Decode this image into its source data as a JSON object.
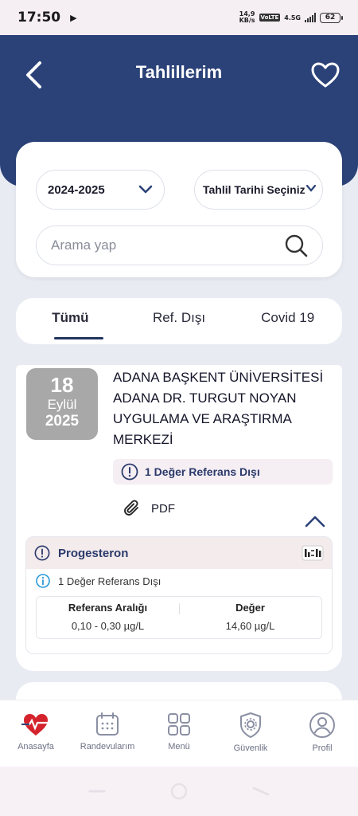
{
  "status_bar": {
    "time": "17:50",
    "speed_top": "14,9",
    "speed_bottom": "KB/s",
    "volte": "VoLTE",
    "network": "4.5G",
    "battery": "62"
  },
  "header": {
    "title": "Tahlillerim"
  },
  "filters": {
    "year_value": "2024-2025",
    "date_placeholder": "Tahlil Tarihi Seçiniz",
    "search_placeholder": "Arama yap"
  },
  "tabs": [
    {
      "label": "Tümü",
      "active": true
    },
    {
      "label": "Ref. Dışı",
      "active": false
    },
    {
      "label": "Covid 19",
      "active": false
    }
  ],
  "result": {
    "day": "18",
    "month": "Eylül",
    "year": "2025",
    "hospital": "ADANA BAŞKENT ÜNİVERSİTESİ ADANA DR. TURGUT NOYAN UYGULAMA VE ARAŞTIRMA MERKEZİ",
    "out_of_ref": "1 Değer Referans Dışı",
    "pdf_label": "PDF",
    "test": {
      "name": "Progesteron",
      "info": "1 Değer Referans Dışı",
      "ref_header": "Referans Aralığı",
      "value_header": "Değer",
      "ref_range": "0,10 - 0,30 µg/L",
      "value": "14,60 µg/L"
    }
  },
  "bottom_nav": [
    {
      "label": "Anasayfa",
      "icon": "heart-pulse-icon"
    },
    {
      "label": "Randevularım",
      "icon": "calendar-icon"
    },
    {
      "label": "Menü",
      "icon": "grid-icon"
    },
    {
      "label": "Güvenlik",
      "icon": "shield-gear-icon"
    },
    {
      "label": "Profil",
      "icon": "user-icon"
    }
  ],
  "colors": {
    "primary": "#2b4278",
    "background": "#e9ebf2",
    "date_badge": "#a8a8a8",
    "alert_bg": "#f5eef3"
  }
}
